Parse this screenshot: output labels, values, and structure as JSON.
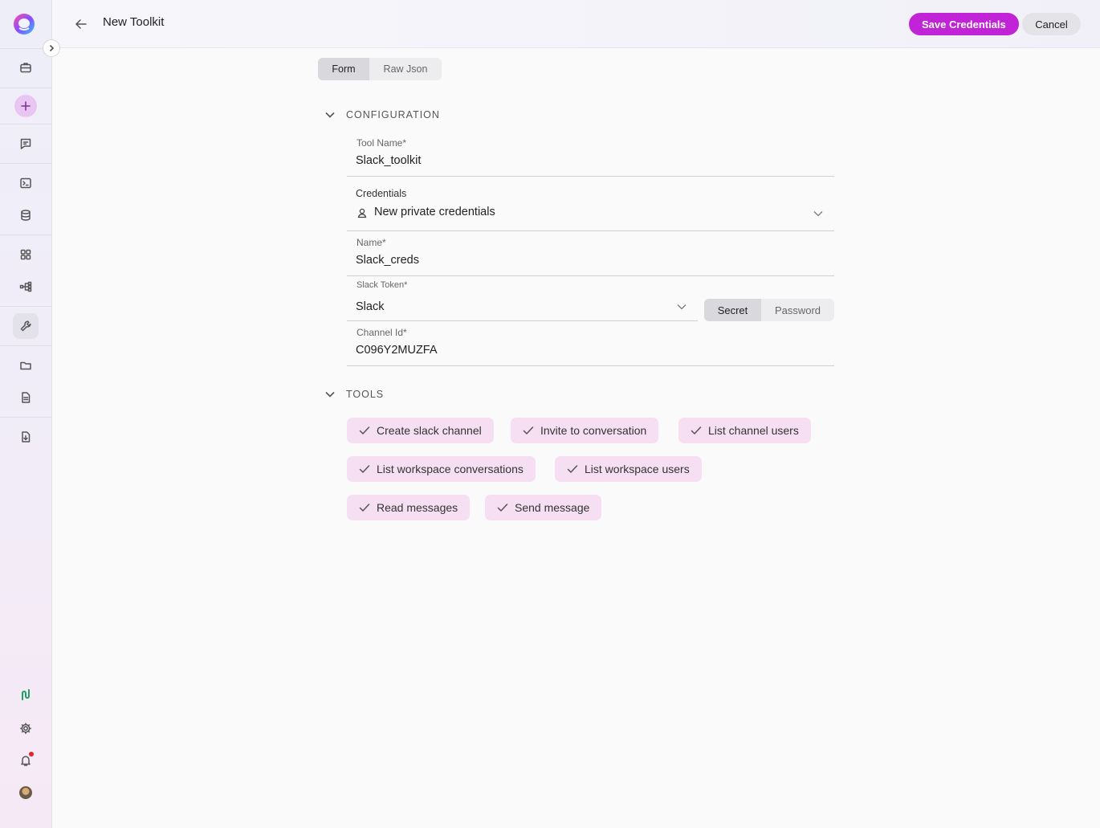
{
  "header": {
    "title": "New Toolkit",
    "save_label": "Save Credentials",
    "cancel_label": "Cancel"
  },
  "view_tabs": [
    {
      "label": "Form",
      "selected": true
    },
    {
      "label": "Raw Json",
      "selected": false
    }
  ],
  "configuration": {
    "section_label": "CONFIGURATION",
    "tool_name": {
      "label": "Tool Name",
      "required": "*",
      "value": "Slack_toolkit"
    },
    "credentials": {
      "label": "Credentials",
      "value": "New private credentials",
      "icon": "user-icon"
    },
    "name": {
      "label": "Name",
      "required": "*",
      "value": "Slack_creds"
    },
    "slack_token": {
      "label": "Slack Token",
      "required": "*",
      "value": "Slack",
      "modes": [
        "Secret",
        "Password"
      ],
      "selected_mode": "Secret"
    },
    "channel_id": {
      "label": "Channel Id",
      "required": "*",
      "value": "C096Y2MUZFA"
    }
  },
  "tools": {
    "section_label": "TOOLS",
    "items": [
      "Create slack channel",
      "Invite to conversation",
      "List channel users",
      "List workspace conversations",
      "List workspace users",
      "Read messages",
      "Send message"
    ]
  },
  "colors": {
    "accent": "#c024d6",
    "chip_bg": "#f7dff3"
  }
}
